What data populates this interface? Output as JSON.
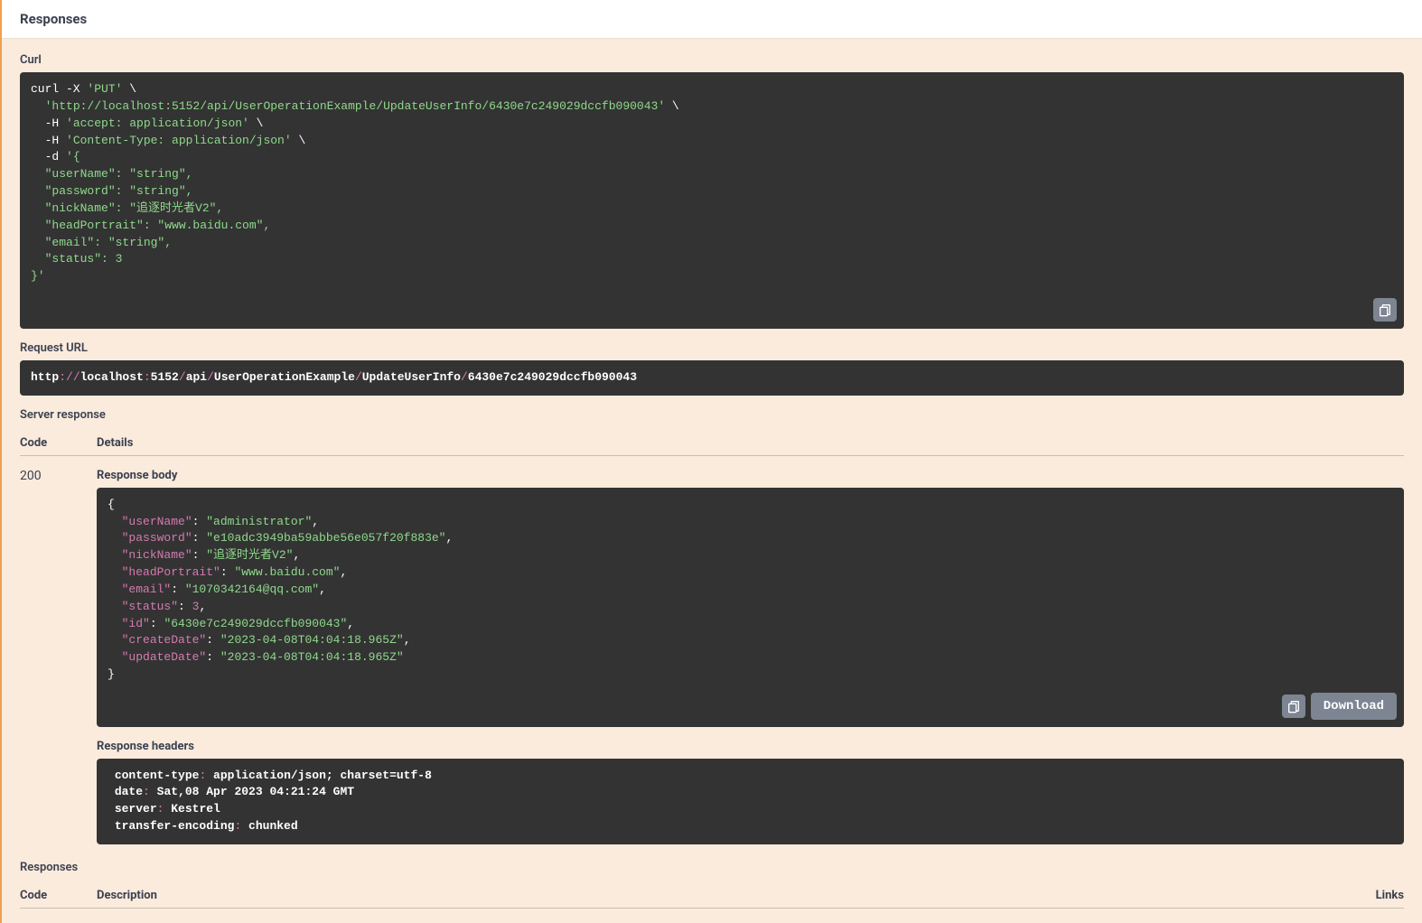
{
  "header": {
    "title": "Responses"
  },
  "curl": {
    "label": "Curl",
    "method": "PUT",
    "url": "http://localhost:5152/api/UserOperationExample/UpdateUserInfo/6430e7c249029dccfb090043",
    "headers": [
      "accept: application/json",
      "Content-Type: application/json"
    ],
    "body_lines": [
      "\"userName\": \"string\",",
      "\"password\": \"string\",",
      "\"nickName\": \"追逐时光者V2\",",
      "\"headPortrait\": \"www.baidu.com\",",
      "\"email\": \"string\",",
      "\"status\": 3"
    ]
  },
  "request_url": {
    "label": "Request URL",
    "value": "http://localhost:5152/api/UserOperationExample/UpdateUserInfo/6430e7c249029dccfb090043"
  },
  "server_response": {
    "label": "Server response",
    "col_code": "Code",
    "col_details": "Details",
    "status": "200",
    "response_body_label": "Response body",
    "response_headers_label": "Response headers",
    "download_label": "Download",
    "body_pairs": [
      {
        "k": "userName",
        "v": "administrator",
        "t": "s"
      },
      {
        "k": "password",
        "v": "e10adc3949ba59abbe56e057f20f883e",
        "t": "s"
      },
      {
        "k": "nickName",
        "v": "追逐时光者V2",
        "t": "s"
      },
      {
        "k": "headPortrait",
        "v": "www.baidu.com",
        "t": "s"
      },
      {
        "k": "email",
        "v": "1070342164@qq.com",
        "t": "s"
      },
      {
        "k": "status",
        "v": "3",
        "t": "n"
      },
      {
        "k": "id",
        "v": "6430e7c249029dccfb090043",
        "t": "s"
      },
      {
        "k": "createDate",
        "v": "2023-04-08T04:04:18.965Z",
        "t": "s"
      },
      {
        "k": "updateDate",
        "v": "2023-04-08T04:04:18.965Z",
        "t": "s"
      }
    ],
    "headers_lines": [
      "content-type: application/json; charset=utf-8 ",
      "date: Sat,08 Apr 2023 04:21:24 GMT ",
      "server: Kestrel ",
      "transfer-encoding: chunked "
    ]
  },
  "responses_section": {
    "label": "Responses",
    "col_code": "Code",
    "col_desc": "Description",
    "col_links": "Links"
  }
}
